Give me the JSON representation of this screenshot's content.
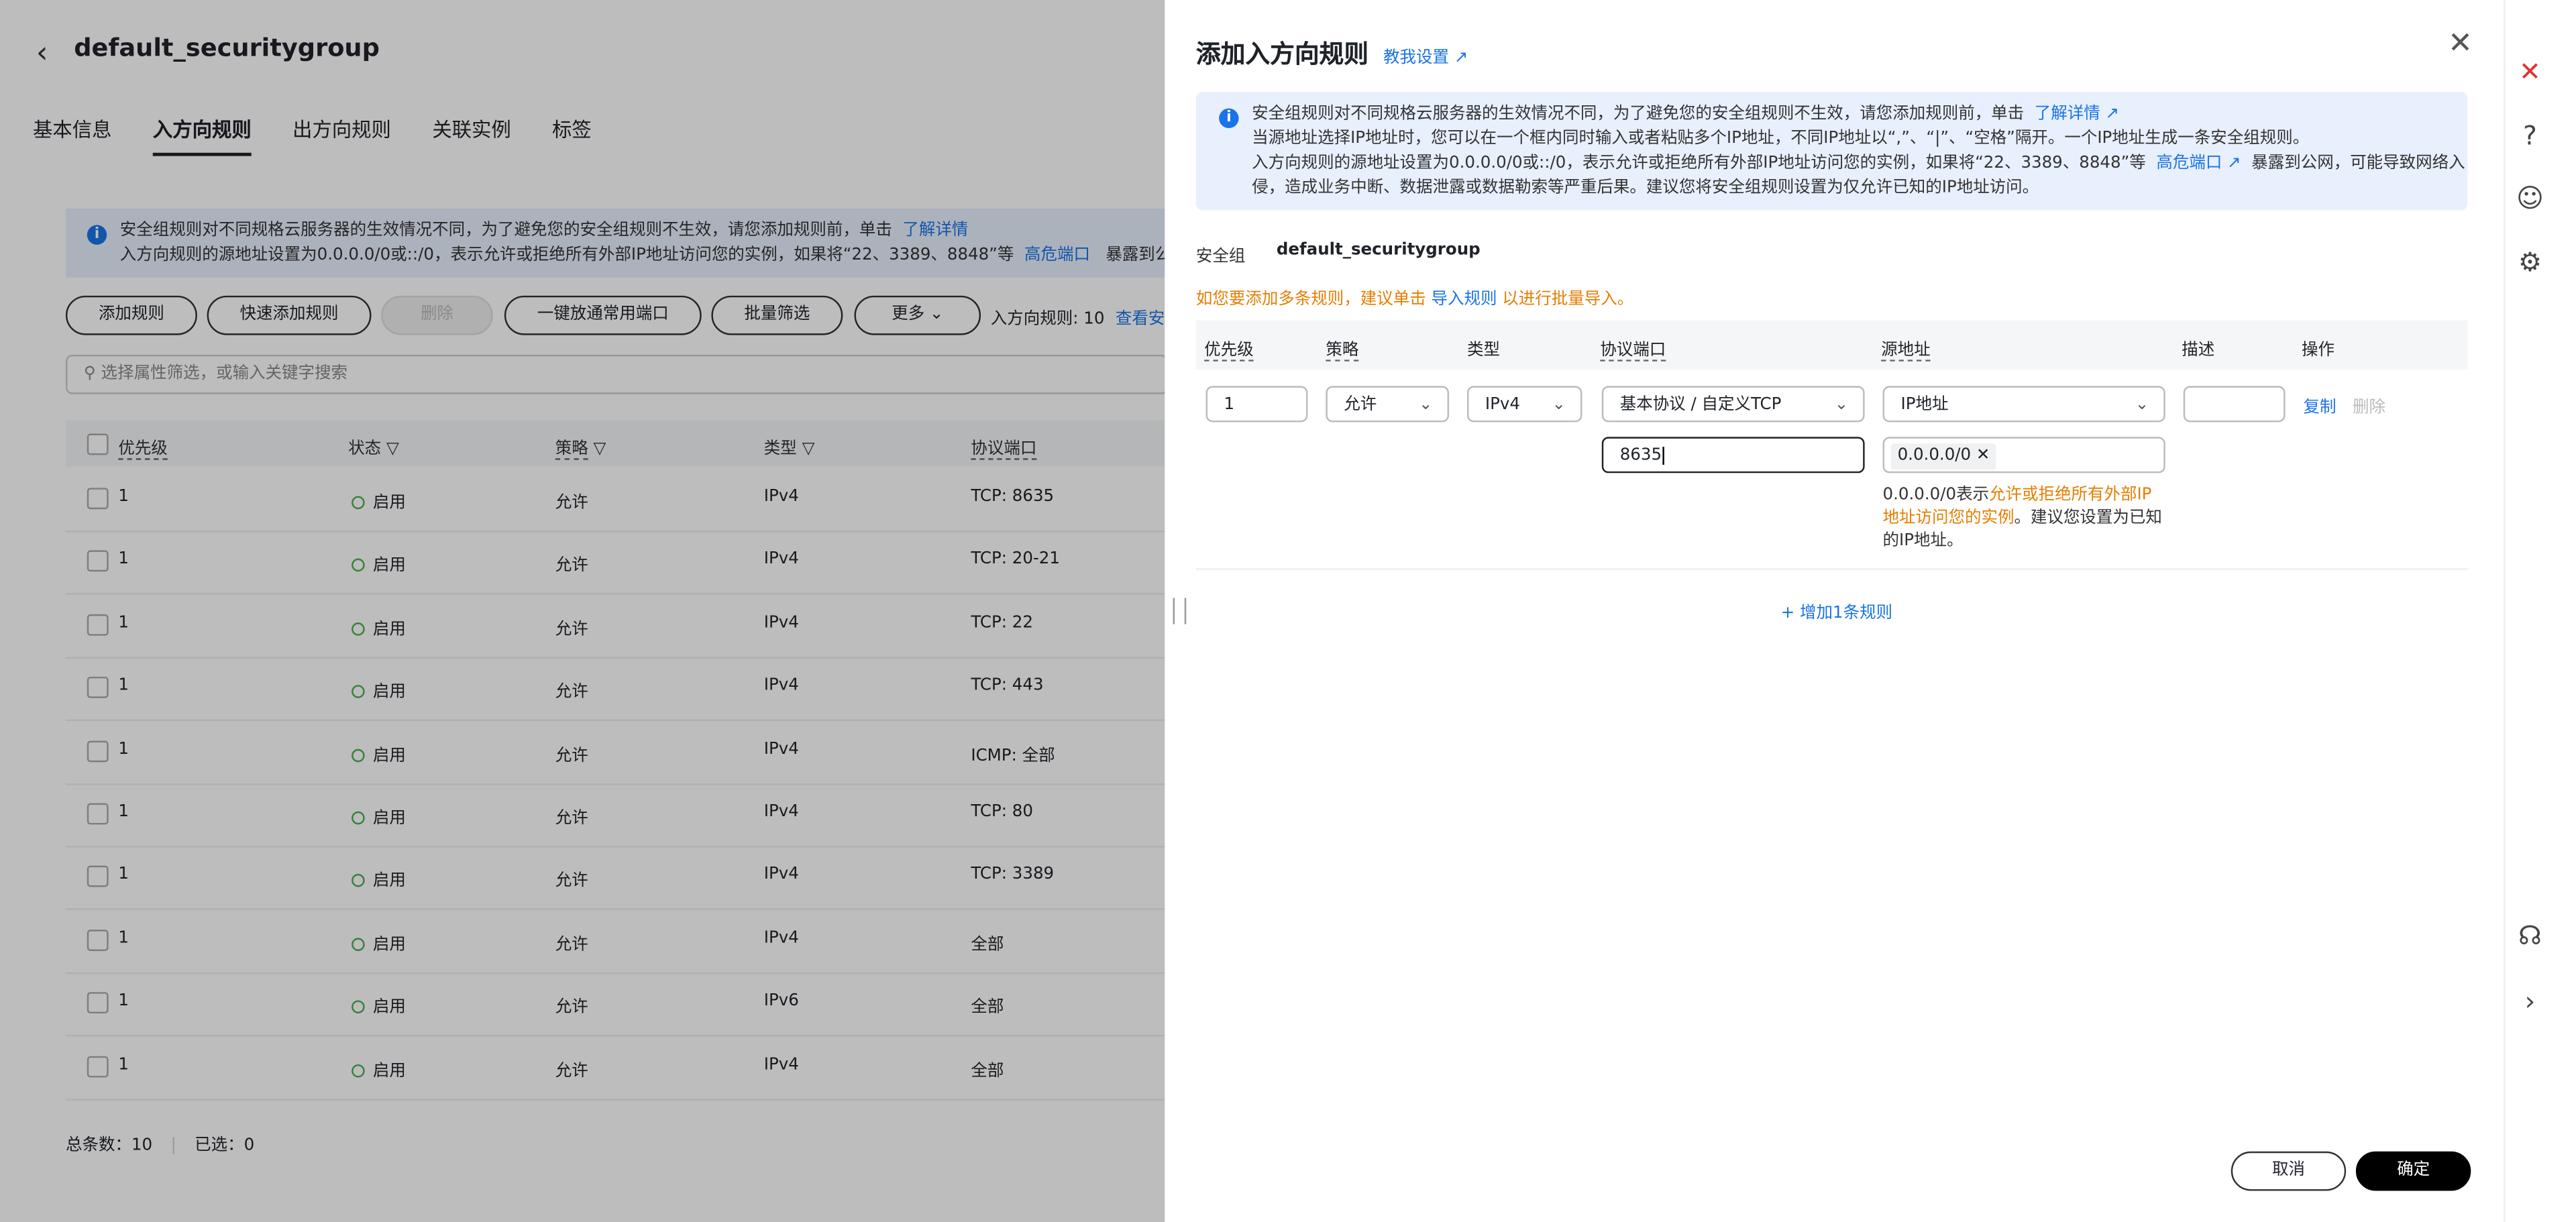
{
  "page": {
    "title": "default_securitygroup",
    "tabs": [
      "基本信息",
      "入方向规则",
      "出方向规则",
      "关联实例",
      "标签"
    ],
    "notice": {
      "line1": "安全组规则对不同规格云服务器的生效情况不同，为了避免您的安全组规则不生效，请您添加规则前，单击",
      "link1": "了解详情",
      "line2": "入方向规则的源地址设置为0.0.0.0/0或::/0，表示允许或拒绝所有外部IP地址访问您的实例，如果将“22、3389、8848”等",
      "link2": "高危端口",
      "line2b": "暴露到公网,"
    },
    "buttons": {
      "add": "添加规则",
      "quick": "快速添加规则",
      "delete": "删除",
      "open_common": "一键放通常用端口",
      "batch_filter": "批量筛选",
      "more": "更多",
      "count": "入方向规则: 10",
      "view": "查看安"
    },
    "search_placeholder": "选择属性筛选，或输入关键字搜索",
    "columns": [
      "优先级",
      "状态",
      "策略",
      "类型",
      "协议端口"
    ],
    "rows": [
      {
        "pri": "1",
        "status": "启用",
        "policy": "允许",
        "type": "IPv4",
        "port": "TCP: 8635"
      },
      {
        "pri": "1",
        "status": "启用",
        "policy": "允许",
        "type": "IPv4",
        "port": "TCP: 20-21"
      },
      {
        "pri": "1",
        "status": "启用",
        "policy": "允许",
        "type": "IPv4",
        "port": "TCP: 22"
      },
      {
        "pri": "1",
        "status": "启用",
        "policy": "允许",
        "type": "IPv4",
        "port": "TCP: 443"
      },
      {
        "pri": "1",
        "status": "启用",
        "policy": "允许",
        "type": "IPv4",
        "port": "ICMP: 全部"
      },
      {
        "pri": "1",
        "status": "启用",
        "policy": "允许",
        "type": "IPv4",
        "port": "TCP: 80"
      },
      {
        "pri": "1",
        "status": "启用",
        "policy": "允许",
        "type": "IPv4",
        "port": "TCP: 3389"
      },
      {
        "pri": "1",
        "status": "启用",
        "policy": "允许",
        "type": "IPv4",
        "port": "全部"
      },
      {
        "pri": "1",
        "status": "启用",
        "policy": "允许",
        "type": "IPv6",
        "port": "全部"
      },
      {
        "pri": "1",
        "status": "启用",
        "policy": "允许",
        "type": "IPv4",
        "port": "全部"
      }
    ],
    "footer": {
      "total": "总条数：10",
      "selected": "已选：0"
    }
  },
  "drawer": {
    "title": "添加入方向规则",
    "help": "教我设置",
    "notice": {
      "l1": "安全组规则对不同规格云服务器的生效情况不同，为了避免您的安全组规则不生效，请您添加规则前，单击",
      "l1_link": "了解详情",
      "l2": "当源地址选择IP地址时，您可以在一个框内同时输入或者粘贴多个IP地址，不同IP地址以“,”、“|”、“空格”隔开。一个IP地址生成一条安全组规则。",
      "l3": "入方向规则的源地址设置为0.0.0.0/0或::/0，表示允许或拒绝所有外部IP地址访问您的实例，如果将“22、3389、8848”等",
      "l3_link": "高危端口",
      "l3b": "暴露到公网，可能导致网络入",
      "l4": "侵，造成业务中断、数据泄露或数据勒索等严重后果。建议您将安全组规则设置为仅允许已知的IP地址访问。"
    },
    "sg_label": "安全组",
    "sg_value": "default_securitygroup",
    "warn_pre": "如您要添加多条规则，建议单击",
    "warn_link": "导入规则",
    "warn_post": "以进行批量导入。",
    "columns": {
      "pri": "优先级",
      "policy": "策略",
      "type": "类型",
      "port": "协议端口",
      "src": "源地址",
      "desc": "描述",
      "op": "操作"
    },
    "rule": {
      "priority": "1",
      "policy": "允许",
      "type": "IPv4",
      "protocol": "基本协议 / 自定义TCP",
      "port": "8635",
      "src_type": "IP地址",
      "src_tag": "0.0.0.0/0",
      "copy": "复制",
      "delete": "删除"
    },
    "hint": {
      "p1": "0.0.0.0/0表示",
      "p2": "允许或拒绝所有外部IP地址访问您的实例",
      "p3": "。建议您设置为已知的IP地址。"
    },
    "add_rule": "+ 增加1条规则",
    "cancel": "取消",
    "confirm": "确定"
  }
}
